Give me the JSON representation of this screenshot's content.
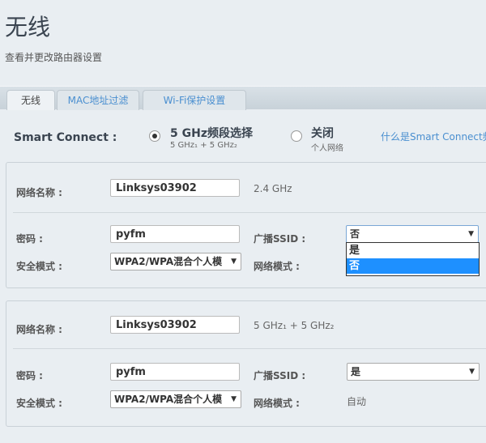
{
  "header": {
    "title": "无线",
    "subtitle": "查看并更改路由器设置"
  },
  "tabs": [
    {
      "label": "无线",
      "active": true
    },
    {
      "label": "MAC地址过滤"
    },
    {
      "label": "Wi-Fi保护设置"
    }
  ],
  "smart_connect": {
    "label": "Smart Connect :",
    "options": [
      {
        "main": "5 GHz频段选择",
        "sub": "5 GHz₁ + 5 GHz₂",
        "selected": true
      },
      {
        "main": "关闭",
        "sub": "个人网络",
        "selected": false
      }
    ],
    "help_link": "什么是Smart Connect频"
  },
  "networks": [
    {
      "name_label": "网络名称 :",
      "name": "Linksys03902",
      "band": "2.4 GHz",
      "password_label": "密码 :",
      "password": "pyfm",
      "broadcast_label": "广播SSID :",
      "broadcast": "否",
      "security_label": "安全模式 :",
      "security": "WPA2/WPA混合个人模",
      "mode_label": "网络模式 :",
      "mode": "",
      "dropdown_open": true,
      "dropdown_options": [
        "是",
        "否"
      ]
    },
    {
      "name_label": "网络名称 :",
      "name": "Linksys03902",
      "band": "5 GHz₁ + 5 GHz₂",
      "password_label": "密码 :",
      "password": "pyfm",
      "broadcast_label": "广播SSID :",
      "broadcast": "是",
      "security_label": "安全模式 :",
      "security": "WPA2/WPA混合个人模",
      "mode_label": "网络模式 :",
      "mode": "自动"
    }
  ],
  "colors": {
    "accent": "#4a8fd0",
    "highlight": "#1e90ff"
  }
}
